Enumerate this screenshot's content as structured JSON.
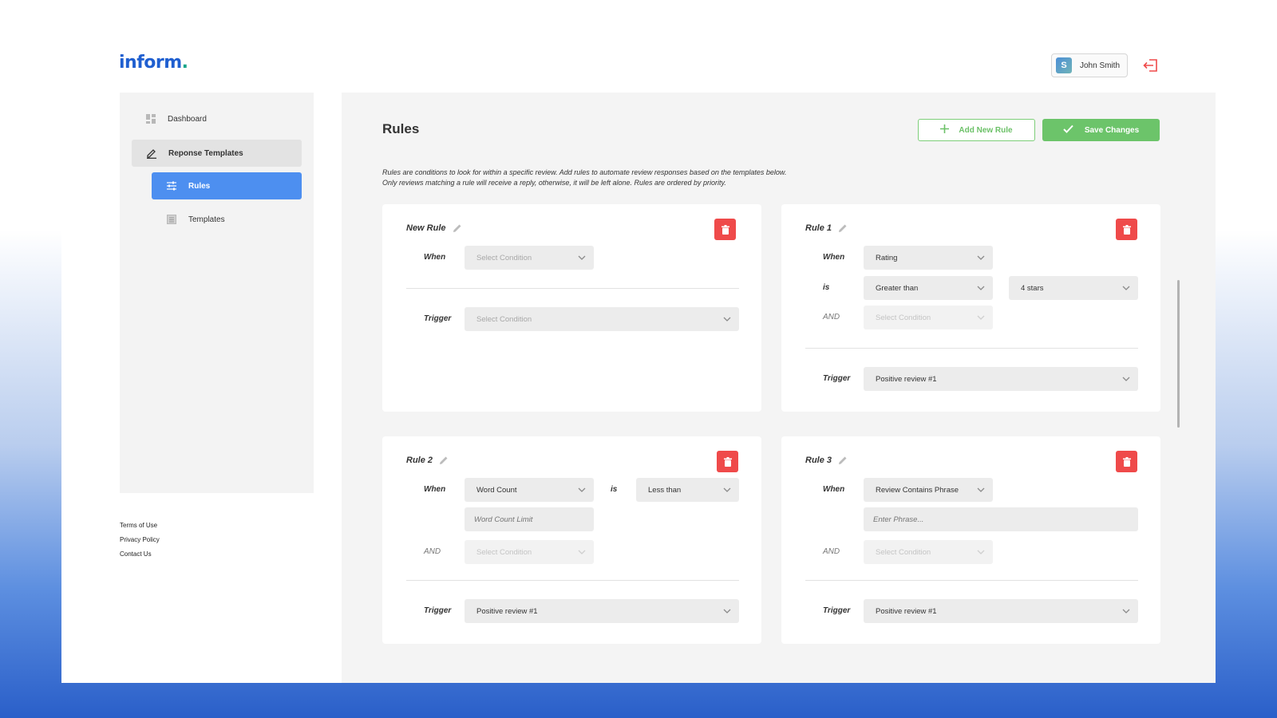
{
  "brand": {
    "name": "inform",
    "dot": "."
  },
  "user": {
    "initial": "S",
    "name": "John Smith"
  },
  "sidebar": {
    "items": [
      {
        "label": "Dashboard"
      },
      {
        "label": "Reponse Templates"
      },
      {
        "label": "Rules"
      },
      {
        "label": "Templates"
      }
    ]
  },
  "footer": {
    "terms": "Terms of Use",
    "privacy": "Privacy Policy",
    "contact": "Contact Us"
  },
  "page": {
    "title": "Rules",
    "add_label": "Add New Rule",
    "save_label": "Save Changes",
    "desc_line1": "Rules are conditions to look for within a specific review. Add rules to automate review responses based on the templates below.",
    "desc_line2": "Only reviews matching a rule will receive a reply, otherwise, it will be left alone. Rules are ordered by priority."
  },
  "labels": {
    "when": "When",
    "is": "is",
    "and": "AND",
    "trigger": "Trigger"
  },
  "rules": [
    {
      "title": "New Rule",
      "when": "Select Condition",
      "trigger": "Select Condition"
    },
    {
      "title": "Rule 1",
      "when": "Rating",
      "operator": "Greater than",
      "value": "4 stars",
      "and": "Select Condition",
      "trigger": "Positive review #1"
    },
    {
      "title": "Rule 2",
      "when": "Word Count",
      "operator": "Less than",
      "input_placeholder": "Word Count Limit",
      "and": "Select Condition",
      "trigger": "Positive review #1"
    },
    {
      "title": "Rule 3",
      "when": "Review Contains Phrase",
      "input_placeholder": "Enter Phrase...",
      "and": "Select Condition",
      "trigger": "Positive review #1"
    }
  ],
  "colors": {
    "brand": "#1f5fd0",
    "active_nav": "#4d8ff0",
    "success": "#6cc46a",
    "danger": "#ef4a4a"
  }
}
